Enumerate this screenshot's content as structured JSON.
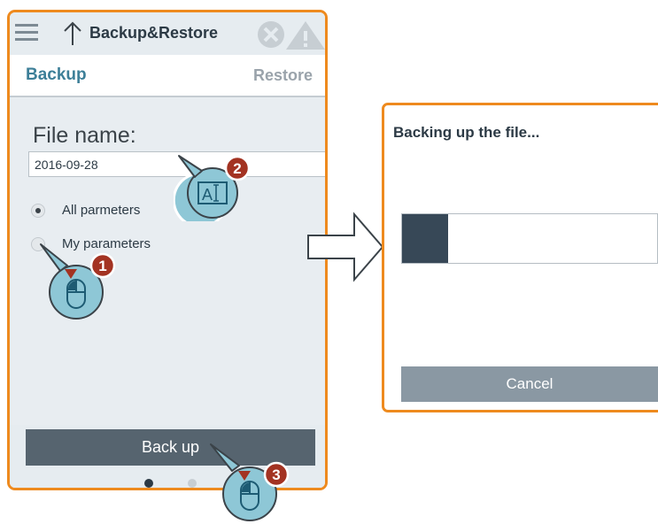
{
  "header": {
    "title": "Backup&Restore"
  },
  "tabs": {
    "backup": "Backup",
    "restore": "Restore"
  },
  "form": {
    "file_label": "File name:",
    "file_value": "2016-09-28",
    "options": [
      {
        "label": "All parmeters",
        "selected": true
      },
      {
        "label": "My parameters",
        "selected": false
      }
    ]
  },
  "actions": {
    "backup_label": "Back up"
  },
  "pager": {
    "page_count": 2,
    "current_page": 1
  },
  "dialog": {
    "title": "Backing up the file...",
    "progress": 0.18,
    "cancel_label": "Cancel"
  },
  "steps": [
    {
      "number": "1",
      "icon": "mouse-click-icon"
    },
    {
      "number": "2",
      "icon": "text-input-icon"
    },
    {
      "number": "3",
      "icon": "mouse-click-icon"
    }
  ],
  "colors": {
    "accent_border": "#ee8a1e",
    "tab_active": "#3d7f98",
    "button_dark": "#56646f",
    "progress_fill": "#374857",
    "step_badge": "#a33322",
    "callout_fill": "#8ec7d6"
  }
}
